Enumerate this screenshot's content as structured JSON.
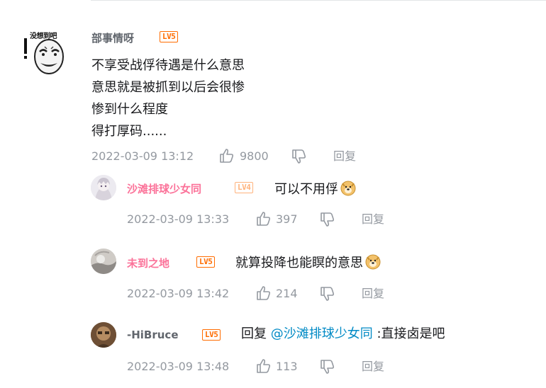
{
  "main_comment": {
    "avatar_caption": "没想到吧",
    "username": "部事情呀",
    "level": "LV5",
    "lines": [
      "不享受战俘待遇是什么意思",
      "意思就是被抓到以后会很惨",
      "惨到什么程度",
      "得打厚码......"
    ],
    "time": "2022-03-09 13:12",
    "likes": "9800",
    "reply_label": "回复"
  },
  "replies": [
    {
      "username": "沙滩排球少女同",
      "level": "LV4",
      "text": "可以不用俘",
      "emoji": "doge-icon",
      "time": "2022-03-09 13:33",
      "likes": "397",
      "reply_label": "回复"
    },
    {
      "username": "未到之地",
      "level": "LV5",
      "text": "就算投降也能瞑的意思",
      "emoji": "doge-icon",
      "time": "2022-03-09 13:42",
      "likes": "214",
      "reply_label": "回复"
    },
    {
      "username": "-HiBruce",
      "level": "LV5",
      "text_prefix": "回复 ",
      "mention": "@沙滩排球少女同",
      "text": " :直接卤是吧",
      "time": "2022-03-09 13:48",
      "likes": "113",
      "reply_label": "回复"
    }
  ],
  "colors": {
    "username_pink": "#fb7299",
    "username_gray": "#61666d",
    "level5": "#ff6c00",
    "level4": "#ffb37c",
    "mention": "#008ac5",
    "meta": "#9499a0"
  }
}
